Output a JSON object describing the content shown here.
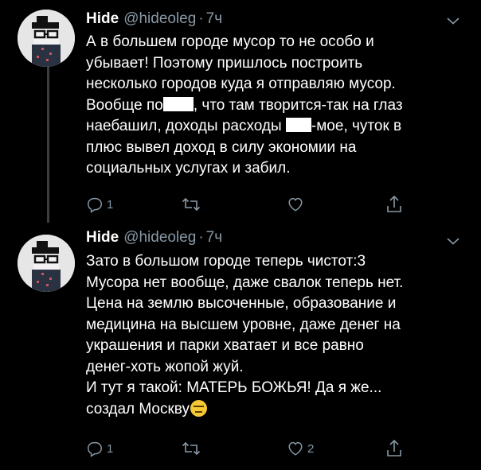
{
  "theme": {
    "background": "#000000",
    "text": "#ffffff",
    "muted": "#8899a6",
    "thread_line": "#3a3f44",
    "redaction": "#ffffff"
  },
  "tweets": [
    {
      "name": "Hide",
      "handle": "@hideoleg",
      "separator": "·",
      "time": "7ч",
      "text_parts": [
        "А в большем городе мусор то не особо и\nубывает! Поэтому пришлось построить\nнесколько городов куда я отправляю мусор.\nВообще по",
        ", что там творится-так на глаз\nнаебашил, доходы расходы ",
        "-мое, чуток в\nплюс вывел доход в силу экономии на\nсоциальных услугах и забил."
      ],
      "reply_count": "1",
      "retweet_count": "",
      "like_count": "",
      "icons": [
        "reply-icon",
        "retweet-icon",
        "heart-icon",
        "share-icon"
      ]
    },
    {
      "name": "Hide",
      "handle": "@hideoleg",
      "separator": "·",
      "time": "7ч",
      "text": "Зато в большом городе теперь чистот:3\nМусора нет вообще, даже свалок теперь нет.\nЦена на землю высоченные, образование и\nмедицина на высшем уровне, даже денег на\nукрашения и парки хватает и все равно\nденег-хоть жопой жуй.\nИ тут я такой: МАТЕРЬ БОЖЬЯ! Да я же...\nсоздал Москву",
      "emoji": "expressionless-face-emoji",
      "reply_count": "1",
      "retweet_count": "",
      "like_count": "2",
      "icons": [
        "reply-icon",
        "retweet-icon",
        "heart-icon",
        "share-icon"
      ]
    }
  ]
}
